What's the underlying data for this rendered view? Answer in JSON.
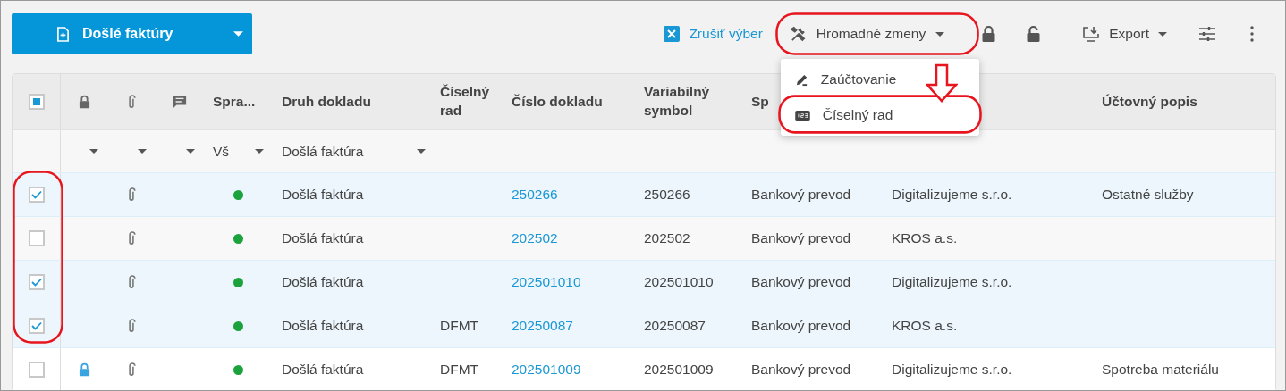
{
  "toolbar": {
    "main_button": {
      "label": "Došlé faktúry"
    },
    "cancel_selection": {
      "label": "Zrušiť výber"
    },
    "bulk_changes": {
      "label": "Hromadné zmeny"
    },
    "export": {
      "label": "Export"
    }
  },
  "bulk_menu": {
    "items": [
      {
        "label": "Zaúčtovanie",
        "kind": "posting",
        "highlighted": false
      },
      {
        "label": "Číselný rad",
        "kind": "numbering",
        "highlighted": true
      }
    ]
  },
  "table": {
    "select_all": {
      "indeterminate": true
    },
    "columns": [
      {
        "kind": "lock",
        "filterable": true
      },
      {
        "kind": "attachment",
        "filterable": true
      },
      {
        "kind": "comment",
        "filterable": true
      },
      {
        "kind": "text",
        "label": "Spra...",
        "filterable": true,
        "filter_value": "Vš"
      },
      {
        "kind": "text",
        "label": "Druh dokladu",
        "filterable": true,
        "filter_value": "Došlá faktúra"
      },
      {
        "kind": "text",
        "label": "Číselný rad"
      },
      {
        "kind": "text",
        "label": "Číslo dokladu"
      },
      {
        "kind": "text",
        "label": "Variabilný symbol"
      },
      {
        "kind": "text",
        "label": "Sp"
      },
      {
        "kind": "text"
      },
      {
        "kind": "text",
        "label": "Účtovný popis"
      }
    ],
    "rows": [
      {
        "selected": true,
        "locked": false,
        "attachment": true,
        "color": "#1ca23c",
        "type": "Došlá faktúra",
        "number": "250266",
        "vs": "250266",
        "payment": "Bankový prevod",
        "partner": "Digitalizujeme s.r.o.",
        "description": "Ostatné služby"
      },
      {
        "selected": false,
        "locked": false,
        "attachment": true,
        "color": "#1ca23c",
        "type": "Došlá faktúra",
        "number": "202502",
        "vs": "202502",
        "payment": "Bankový prevod",
        "partner": "KROS a.s."
      },
      {
        "selected": true,
        "locked": false,
        "attachment": true,
        "color": "#1ca23c",
        "type": "Došlá faktúra",
        "number": "202501010",
        "vs": "202501010",
        "payment": "Bankový prevod",
        "partner": "Digitalizujeme s.r.o."
      },
      {
        "selected": true,
        "locked": false,
        "attachment": true,
        "color": "#1ca23c",
        "type": "Došlá faktúra",
        "series": "DFMT",
        "number": "20250087",
        "vs": "20250087",
        "payment": "Bankový prevod",
        "partner": "KROS a.s."
      },
      {
        "selected": false,
        "locked": true,
        "attachment": true,
        "color": "#1ca23c",
        "type": "Došlá faktúra",
        "series": "DFMT",
        "number": "202501009",
        "vs": "202501009",
        "payment": "Bankový prevod",
        "partner": "Digitalizujeme s.r.o.",
        "description": "Spotreba materiálu"
      }
    ]
  }
}
